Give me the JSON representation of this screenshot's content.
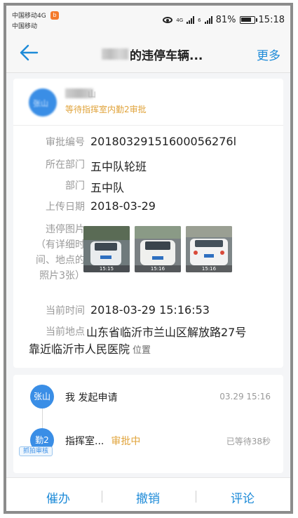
{
  "status_bar": {
    "carrier_line1": "中国移动4G",
    "carrier_line2": "中国移动",
    "network_tag": "4G",
    "sim_tag": "6",
    "battery": "81%",
    "time": "15:18"
  },
  "header": {
    "title": "的违停车辆...",
    "more_label": "更多"
  },
  "applicant": {
    "name_partial": "山",
    "status": "等待指挥室内勤2审批"
  },
  "details": {
    "approval_no_label": "审批编号",
    "approval_no": "20180329151600056276l",
    "dept_label": "所在部门",
    "dept": "五中队轮班",
    "dept2_label": "部门",
    "dept2": "五中队",
    "upload_date_label": "上传日期",
    "upload_date": "2018-03-29",
    "photos_label": "违停图片（有详细时间、地点的照片3张）",
    "photo_stamps": [
      "15:15",
      "15:16",
      "15:16"
    ],
    "current_time_label": "当前时间",
    "current_time": "2018-03-29 15:16:53",
    "location_label": "当前地点",
    "location_line1": "山东省临沂市兰山区解放路27号",
    "location_line2": "靠近临沂市人民医院",
    "location_link": "位置"
  },
  "timeline": [
    {
      "node": "张山",
      "text": "我 发起申请",
      "highlight": "",
      "time": "03.29 15:16"
    },
    {
      "node": "勤2",
      "text": "指挥室...",
      "highlight": "审批中",
      "time": "已等待38秒",
      "tag": "抓拍审核"
    }
  ],
  "bottom_bar": {
    "urge": "催办",
    "revoke": "撤销",
    "comment": "评论"
  },
  "colors": {
    "accent": "#1e8bd8",
    "pending": "#e0a33a",
    "avatar": "#3a8ee6"
  }
}
